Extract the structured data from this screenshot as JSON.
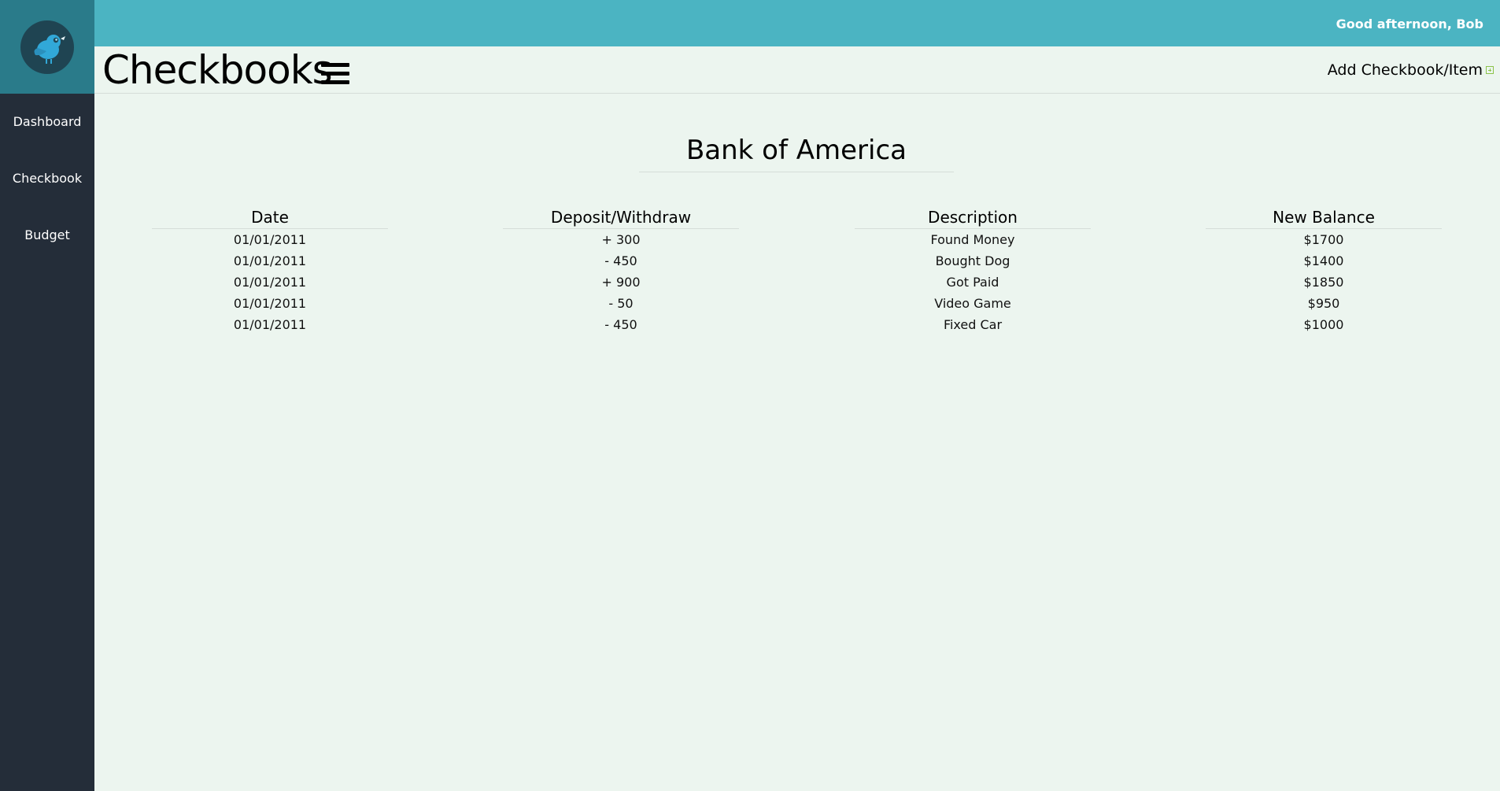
{
  "header": {
    "greeting": "Good afternoon, Bob",
    "page_title": "Checkbooks",
    "add_link": "Add Checkbook/Item"
  },
  "sidebar": {
    "items": [
      {
        "label": "Dashboard"
      },
      {
        "label": "Checkbook"
      },
      {
        "label": "Budget"
      }
    ]
  },
  "checkbook": {
    "title": "Bank of America",
    "columns": [
      "Date",
      "Deposit/Withdraw",
      "Description",
      "New Balance"
    ],
    "rows": [
      [
        "01/01/2011",
        "+ 300",
        "Found Money",
        "$1700"
      ],
      [
        "01/01/2011",
        "- 450",
        "Bought Dog",
        "$1400"
      ],
      [
        "01/01/2011",
        "+ 900",
        "Got Paid",
        "$1850"
      ],
      [
        "01/01/2011",
        "- 50",
        "Video Game",
        "$950"
      ],
      [
        "01/01/2011",
        "- 450",
        "Fixed Car",
        "$1000"
      ]
    ]
  },
  "colors": {
    "topbar": "#4bb4c2",
    "sidebar": "#242d39",
    "logo_bg": "#2a7b8a",
    "page_bg": "#ecf5ef",
    "add_icon": "#8bc34a"
  },
  "icons": {
    "logo": "bird-logo-icon",
    "menu": "hamburger-menu-icon",
    "add": "plus-square-icon"
  }
}
